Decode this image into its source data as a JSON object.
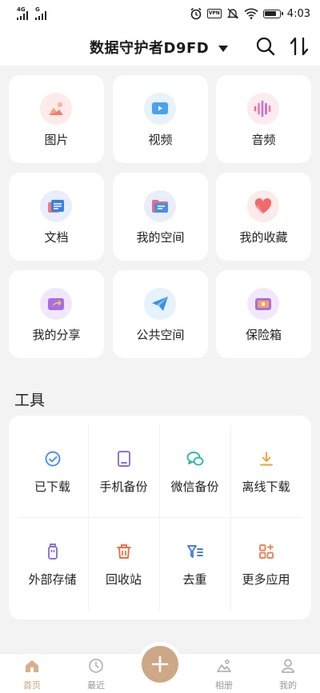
{
  "status_bar": {
    "sim1_label": "4G",
    "sim2_label": "G",
    "vpn_label": "VPN",
    "time": "4:03",
    "battery_level": 0.85,
    "icons": [
      "alarm-icon",
      "vpn-icon",
      "mute-icon",
      "wifi-icon",
      "battery-icon"
    ]
  },
  "header": {
    "space_name": "数据守护者D9FD",
    "actions": [
      "search-icon",
      "sort-icon"
    ]
  },
  "categories": [
    {
      "label": "图片",
      "icon": "image-icon",
      "bg": "#fdeaea"
    },
    {
      "label": "视频",
      "icon": "video-icon",
      "bg": "#e7f2fb"
    },
    {
      "label": "音频",
      "icon": "audio-icon",
      "bg": "#fcecef"
    },
    {
      "label": "文档",
      "icon": "document-icon",
      "bg": "#e8eefb"
    },
    {
      "label": "我的空间",
      "icon": "folder-icon",
      "bg": "#e8eefb"
    },
    {
      "label": "我的收藏",
      "icon": "heart-icon",
      "bg": "#fdeaea"
    },
    {
      "label": "我的分享",
      "icon": "share-icon",
      "bg": "#f0e8fa"
    },
    {
      "label": "公共空间",
      "icon": "paper-plane-icon",
      "bg": "#e6f2fc"
    },
    {
      "label": "保险箱",
      "icon": "safe-icon",
      "bg": "#f1e9fb"
    }
  ],
  "tools": {
    "title": "工具",
    "items": [
      {
        "label": "已下载",
        "icon": "downloaded-check-icon",
        "color": "#4a90e2"
      },
      {
        "label": "手机备份",
        "icon": "phone-backup-icon",
        "color": "#8b6fd8"
      },
      {
        "label": "微信备份",
        "icon": "wechat-backup-icon",
        "color": "#2fb9a0"
      },
      {
        "label": "离线下载",
        "icon": "offline-download-icon",
        "color": "#f0a23a"
      },
      {
        "label": "外部存储",
        "icon": "usb-storage-icon",
        "color": "#8b6fd8"
      },
      {
        "label": "回收站",
        "icon": "recycle-bin-icon",
        "color": "#e8704a"
      },
      {
        "label": "去重",
        "icon": "dedupe-icon",
        "color": "#4a7fd0"
      },
      {
        "label": "更多应用",
        "icon": "more-apps-icon",
        "color": "#e8855a"
      }
    ]
  },
  "bottom_nav": {
    "items": [
      {
        "label": "首页",
        "icon": "home-icon",
        "active": true
      },
      {
        "label": "最近",
        "icon": "clock-icon",
        "active": false
      },
      {
        "label": "相册",
        "icon": "album-icon",
        "active": false
      },
      {
        "label": "我的",
        "icon": "user-icon",
        "active": false
      }
    ],
    "fab_icon": "plus-icon"
  },
  "colors": {
    "accent": "#cda886",
    "background": "#f3f3f3",
    "card": "#ffffff"
  }
}
